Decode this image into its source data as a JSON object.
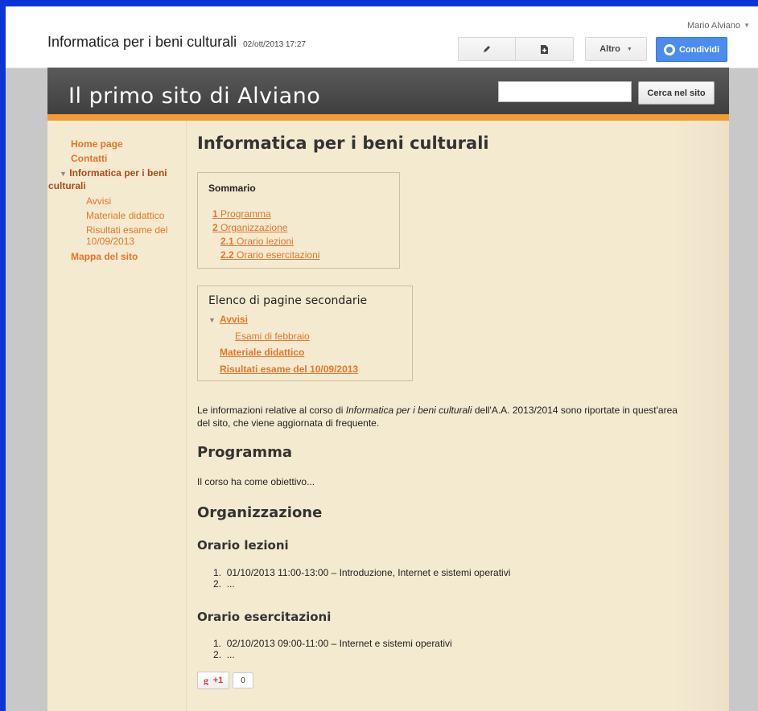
{
  "user": {
    "name": "Mario Alviano"
  },
  "document": {
    "title": "Informatica per i beni culturali",
    "date": "02/ott/2013 17:27"
  },
  "toolbar": {
    "edit_icon": "pencil-icon",
    "newpage_icon": "new-page-icon",
    "more_label": "Altro",
    "share_label": "Condividi"
  },
  "site": {
    "title": "Il primo sito di Alviano",
    "search_placeholder": "",
    "search_button": "Cerca nel sito"
  },
  "nav": {
    "home": "Home page",
    "contatti": "Contatti",
    "current_line1": "Informatica per i beni",
    "current_line2": "culturali",
    "sub": [
      "Avvisi",
      "Materiale didattico",
      "Risultati esame del",
      "10/09/2013"
    ],
    "map": "Mappa del sito"
  },
  "page": {
    "title": "Informatica per i beni culturali",
    "toc": {
      "title": "Sommario",
      "items": [
        {
          "num": "1",
          "text": "Programma"
        },
        {
          "num": "2",
          "text": "Organizzazione"
        },
        {
          "num": "2.1",
          "text": "Orario lezioni"
        },
        {
          "num": "2.2",
          "text": "Orario esercitazioni"
        }
      ]
    },
    "subpages": {
      "title": "Elenco di pagine secondarie",
      "avvisi": "Avvisi",
      "esami": "Esami di febbraio",
      "materiale": "Materiale didattico",
      "risultati": "Risultati esame del 10/09/2013"
    },
    "intro_a": "Le informazioni relative al corso di ",
    "intro_em": "Informatica per i beni culturali",
    "intro_b": " dell'A.A. 2013/2014 sono riportate in quest'area del sito, che viene aggiornata di frequente.",
    "programma_heading": "Programma",
    "programma_text": "Il corso ha come obiettivo...",
    "organizzazione_heading": "Organizzazione",
    "lezioni_heading": "Orario lezioni",
    "lezioni": [
      "01/10/2013 11:00-13:00 – Introduzione, Internet e sistemi operativi",
      "..."
    ],
    "esercitazioni_heading": "Orario esercitazioni",
    "esercitazioni": [
      "02/10/2013 09:00-11:00 – Internet e sistemi operativi",
      "..."
    ],
    "plusone_label": "+1",
    "plusone_count": "0"
  }
}
